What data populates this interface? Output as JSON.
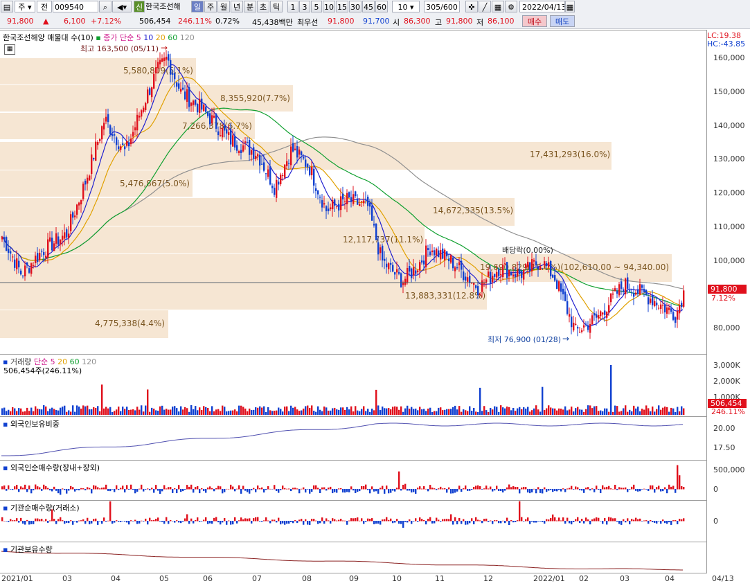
{
  "toolbar": {
    "type_select": "주",
    "prev_label": "전",
    "code": "009540",
    "tag_badge": "신",
    "stock_name": "한국조선해",
    "periods": [
      "일",
      "주",
      "월",
      "년",
      "분",
      "초",
      "틱"
    ],
    "minutes": [
      "1",
      "3",
      "5",
      "10",
      "15",
      "30",
      "45",
      "60"
    ],
    "interval": "10",
    "count": "305/600",
    "date": "2022/04/13"
  },
  "quote": {
    "price": "91,800",
    "change": "6,100",
    "change_pct": "+7.12%",
    "volume": "506,454",
    "volume_pct": "246.11%",
    "turnover_pct": "0.72%",
    "amount": "45,438백만",
    "ask_label": "최우선",
    "ask1": "91,800",
    "bid1": "91,700",
    "open_label": "시",
    "open": "86,300",
    "high_label": "고",
    "high": "91,800",
    "low_label": "저",
    "low": "86,100",
    "buy_label": "매수",
    "sell_label": "매도"
  },
  "price_panel": {
    "title": "한국조선해양 매물대 수(10)",
    "ma_label": "종가 단순",
    "ma_periods": [
      "5",
      "10",
      "20",
      "60",
      "120"
    ],
    "ma_colors": [
      "#d02090",
      "#2020d0",
      "#e0a000",
      "#10a030",
      "#909090"
    ],
    "lc": "LC:19.38",
    "hc": "HC:-43.85",
    "high_note": "최고 163,500 (05/11)",
    "low_note": "최저 76,900 (01/28)",
    "dividend_note": "배당락(0.00%)",
    "y_ticks": [
      "160,000",
      "150,000",
      "140,000",
      "130,000",
      "120,000",
      "110,000",
      "100,000",
      "80,000"
    ],
    "current_price": "91,800",
    "current_pct": "7.12%",
    "bands": [
      {
        "label": "5,580,809(5.1%)"
      },
      {
        "label": "8,355,920(7.7%)"
      },
      {
        "label": "7,266,378(6.7%)"
      },
      {
        "label": "17,431,293(16.0%)"
      },
      {
        "label": "5,476,867(5.0%)"
      },
      {
        "label": "14,672,335(13.5%)"
      },
      {
        "label": "12,117,737(11.1%)"
      },
      {
        "label": "19,690,829(18.0%)(102,610.00 ~ 94,340.00)"
      },
      {
        "label": "13,883,331(12.8%)"
      },
      {
        "label": "4,775,338(4.4%)"
      }
    ]
  },
  "volume_panel": {
    "title": "거래량",
    "ma_label": "단순",
    "ma_periods": [
      "5",
      "20",
      "60",
      "120"
    ],
    "summary": "506,454주(246.11%)",
    "y_ticks": [
      "3,000K",
      "2,000K",
      "1,000K"
    ],
    "current": "506,454",
    "current_pct": "246.11%"
  },
  "foreign_ratio_panel": {
    "title": "외국인보유비중",
    "y_ticks": [
      "20.00",
      "17.50"
    ]
  },
  "foreign_net_panel": {
    "title": "외국인순매수량(장내+장외)",
    "y_ticks": [
      "500,000",
      "0"
    ]
  },
  "inst_net_panel": {
    "title": "기관순매수량(거래소)",
    "y_ticks": [
      "0"
    ]
  },
  "inst_hold_panel": {
    "title": "기관보유수량"
  },
  "x_axis": [
    "2021/01",
    "03",
    "04",
    "05",
    "06",
    "07",
    "08",
    "09",
    "10",
    "11",
    "12",
    "2022/01",
    "02",
    "03",
    "04",
    "04/13"
  ],
  "colors": {
    "up": "#e0101c",
    "down": "#1040d0",
    "band": "#f6e6d3"
  }
}
